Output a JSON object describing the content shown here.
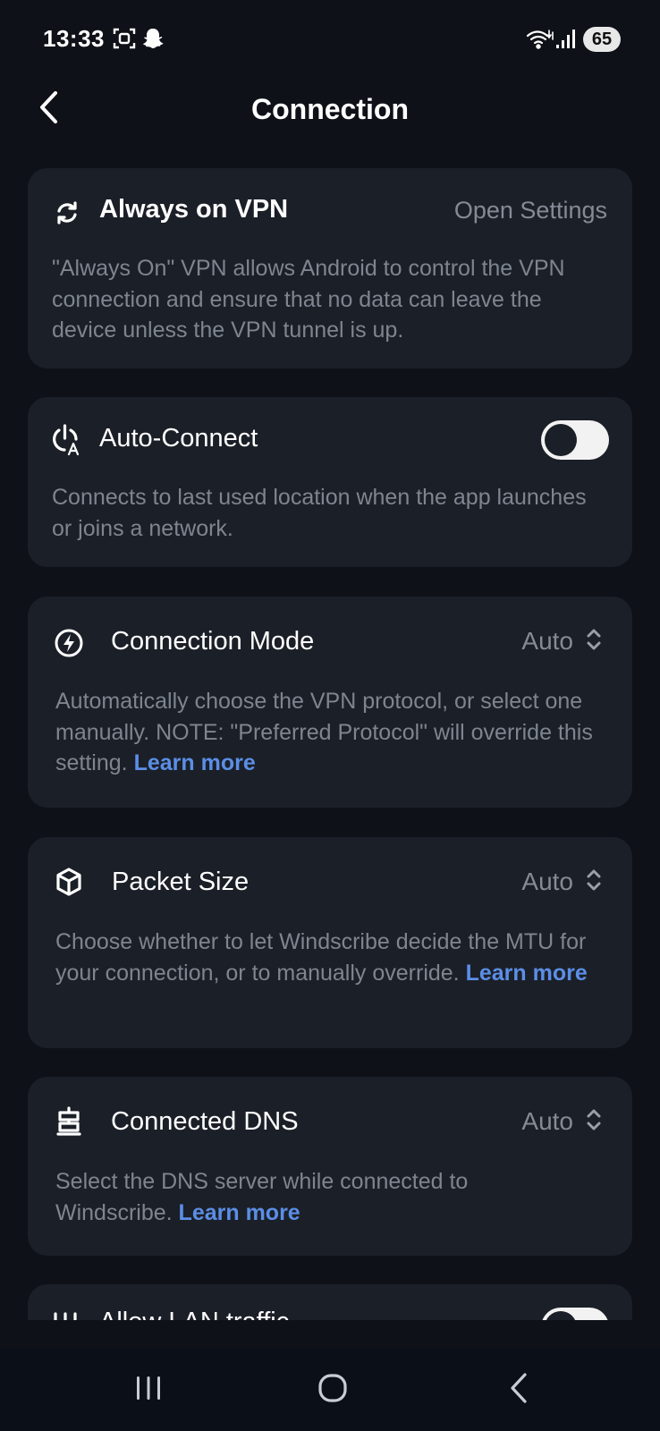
{
  "status_bar": {
    "time": "13:33",
    "battery": "65",
    "icons": [
      "screenshot-icon",
      "snapchat-icon",
      "wifi-icon",
      "signal-icon"
    ]
  },
  "header": {
    "title": "Connection",
    "back_icon": "chevron-left-icon"
  },
  "cards": {
    "always_on": {
      "icon": "sync-icon",
      "title": "Always on VPN",
      "action": "Open Settings",
      "description": "\"Always On\" VPN allows Android to control the VPN connection and ensure that no data can leave the device unless the VPN tunnel is up."
    },
    "auto_connect": {
      "icon": "power-auto-icon",
      "title": "Auto-Connect",
      "toggle_on": false,
      "description": "Connects to last used location when the app launches or joins a network."
    },
    "connection_mode": {
      "icon": "lightning-icon",
      "title": "Connection Mode",
      "value": "Auto",
      "description": "Automatically choose the VPN protocol, or select one manually. NOTE: \"Preferred Protocol\" will override this setting. ",
      "link": "Learn more"
    },
    "packet_size": {
      "icon": "cube-icon",
      "title": "Packet Size",
      "value": "Auto",
      "description": "Choose whether to let Windscribe decide the MTU for your connection, or to manually override. ",
      "link": "Learn more"
    },
    "connected_dns": {
      "icon": "dns-icon",
      "title": "Connected DNS",
      "value": "Auto",
      "description": "Select the DNS server while connected to Windscribe. ",
      "link": "Learn more"
    },
    "lan_traffic": {
      "icon": "lan-icon",
      "title": "Allow LAN traffic",
      "toggle_on": false
    }
  },
  "nav_bar": {
    "recents_icon": "recents-icon",
    "home_icon": "home-icon",
    "back_icon": "back-icon"
  },
  "colors": {
    "background": "#0e1117",
    "card": "#1b1f27",
    "text_secondary": "#7f8590",
    "link": "#5b8ee6"
  }
}
